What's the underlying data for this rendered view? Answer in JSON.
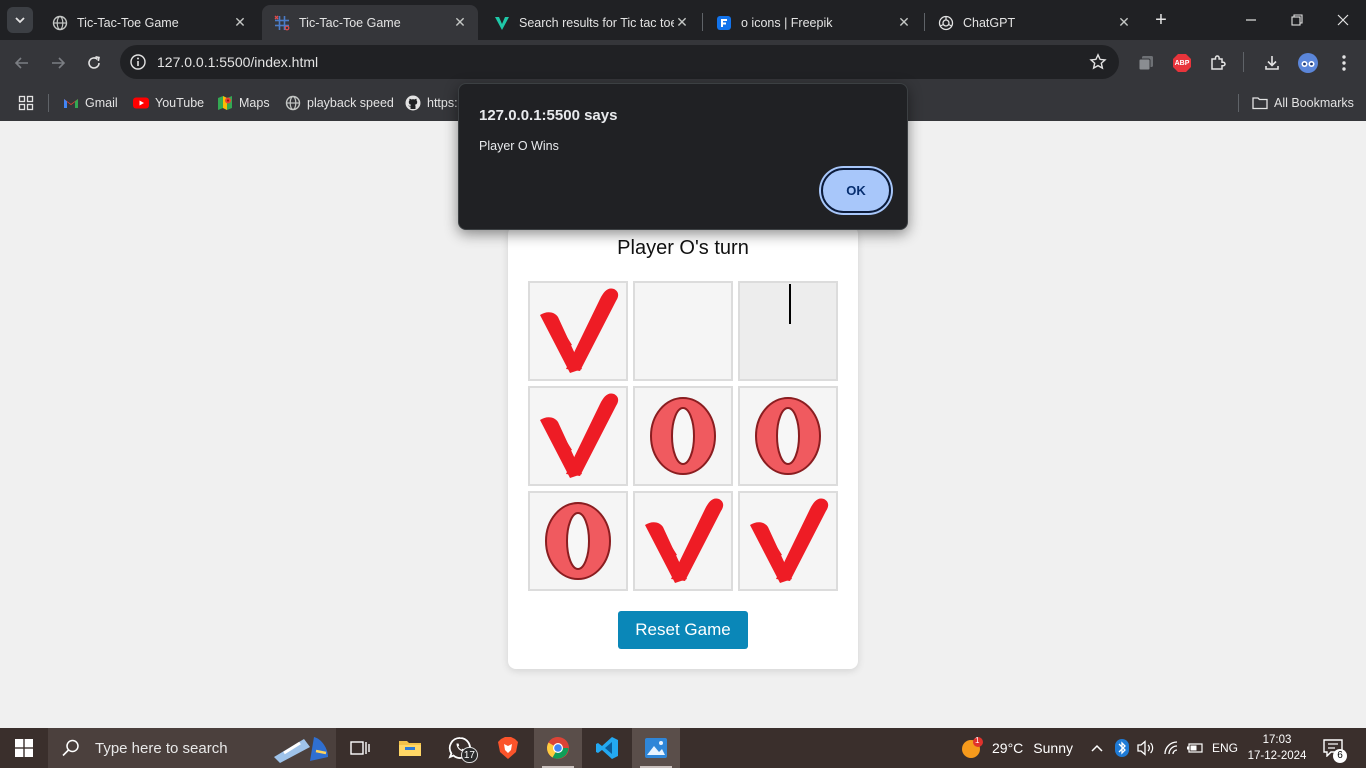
{
  "browser": {
    "tabs": [
      {
        "title": "Tic-Tac-Toe Game",
        "icon": "globe-icon",
        "active": false
      },
      {
        "title": "Tic-Tac-Toe Game",
        "icon": "tictactoe-favicon",
        "active": true
      },
      {
        "title": "Search results for Tic tac toe",
        "icon": "vectorizer-icon",
        "active": false
      },
      {
        "title": "o icons | Freepik",
        "icon": "freepik-icon",
        "active": false
      },
      {
        "title": "ChatGPT",
        "icon": "chatgpt-icon",
        "active": false
      }
    ],
    "url": "127.0.0.1:5500/index.html",
    "extensions": {
      "adblock_label": "ABP"
    },
    "bookmarks": [
      {
        "label": "Gmail",
        "icon": "gmail-icon"
      },
      {
        "label": "YouTube",
        "icon": "youtube-icon"
      },
      {
        "label": "Maps",
        "icon": "maps-icon"
      },
      {
        "label": "playback speed",
        "icon": "globe-icon"
      },
      {
        "label": "https:",
        "icon": "github-icon"
      }
    ],
    "all_bookmarks_label": "All Bookmarks"
  },
  "game": {
    "status": "Player O's turn",
    "board": [
      "X",
      "",
      "",
      "X",
      "O",
      "O",
      "O",
      "X",
      "X"
    ],
    "reset_label": "Reset Game",
    "x_color": "#ee1c25",
    "o_color": "#f05a5f"
  },
  "alert": {
    "origin": "127.0.0.1:5500 says",
    "message": "Player O Wins",
    "ok_label": "OK"
  },
  "taskbar": {
    "search_placeholder": "Type here to search",
    "whatsapp_badge": "17",
    "weather": {
      "temp": "29°C",
      "condition": "Sunny",
      "alert_count": "1"
    },
    "language": "ENG",
    "time": "17:03",
    "date": "17-12-2024",
    "notifications": "6"
  }
}
